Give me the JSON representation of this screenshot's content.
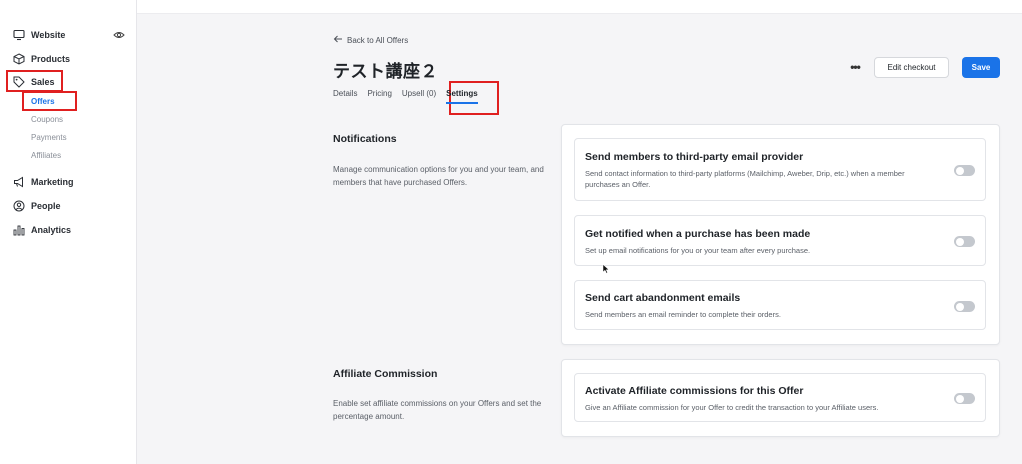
{
  "sidebar": {
    "items": [
      {
        "label": "Website",
        "icon": "monitor-icon"
      },
      {
        "label": "Products",
        "icon": "box-icon"
      },
      {
        "label": "Sales",
        "icon": "tag-icon"
      },
      {
        "label": "Marketing",
        "icon": "megaphone-icon"
      },
      {
        "label": "People",
        "icon": "person-icon"
      },
      {
        "label": "Analytics",
        "icon": "bar-chart-icon"
      }
    ],
    "sales_sub": [
      {
        "label": "Offers",
        "active": true
      },
      {
        "label": "Coupons"
      },
      {
        "label": "Payments"
      },
      {
        "label": "Affiliates"
      }
    ]
  },
  "header": {
    "back_label": "Back to All Offers",
    "title": "テスト講座２",
    "edit_checkout_label": "Edit checkout",
    "save_label": "Save",
    "more_label": "•••",
    "tabs": [
      {
        "label": "Details"
      },
      {
        "label": "Pricing"
      },
      {
        "label": "Upsell (0)"
      },
      {
        "label": "Settings",
        "active": true
      }
    ]
  },
  "notifications": {
    "title": "Notifications",
    "description": "Manage communication options for you and your team, and members that have purchased Offers.",
    "cards": [
      {
        "title": "Send members to third-party email provider",
        "description": "Send contact information to third-party platforms (Mailchimp, Aweber, Drip, etc.) when a member purchases an Offer.",
        "enabled": false
      },
      {
        "title": "Get notified when a purchase has been made",
        "description": "Set up email notifications for you or your team after every purchase.",
        "enabled": false
      },
      {
        "title": "Send cart abandonment emails",
        "description": "Send members an email reminder to complete their orders.",
        "enabled": false
      }
    ]
  },
  "affiliate": {
    "title": "Affiliate Commission",
    "description": "Enable set affiliate commissions on your Offers and set the percentage amount.",
    "cards": [
      {
        "title": "Activate Affiliate commissions for this Offer",
        "description": "Give an Affiliate commission for your Offer to credit the transaction to your Affiliate users.",
        "enabled": false
      }
    ]
  },
  "colors": {
    "accent": "#1a73e8",
    "highlight": "#e02020",
    "toggle_off": "#c4c8ce"
  }
}
